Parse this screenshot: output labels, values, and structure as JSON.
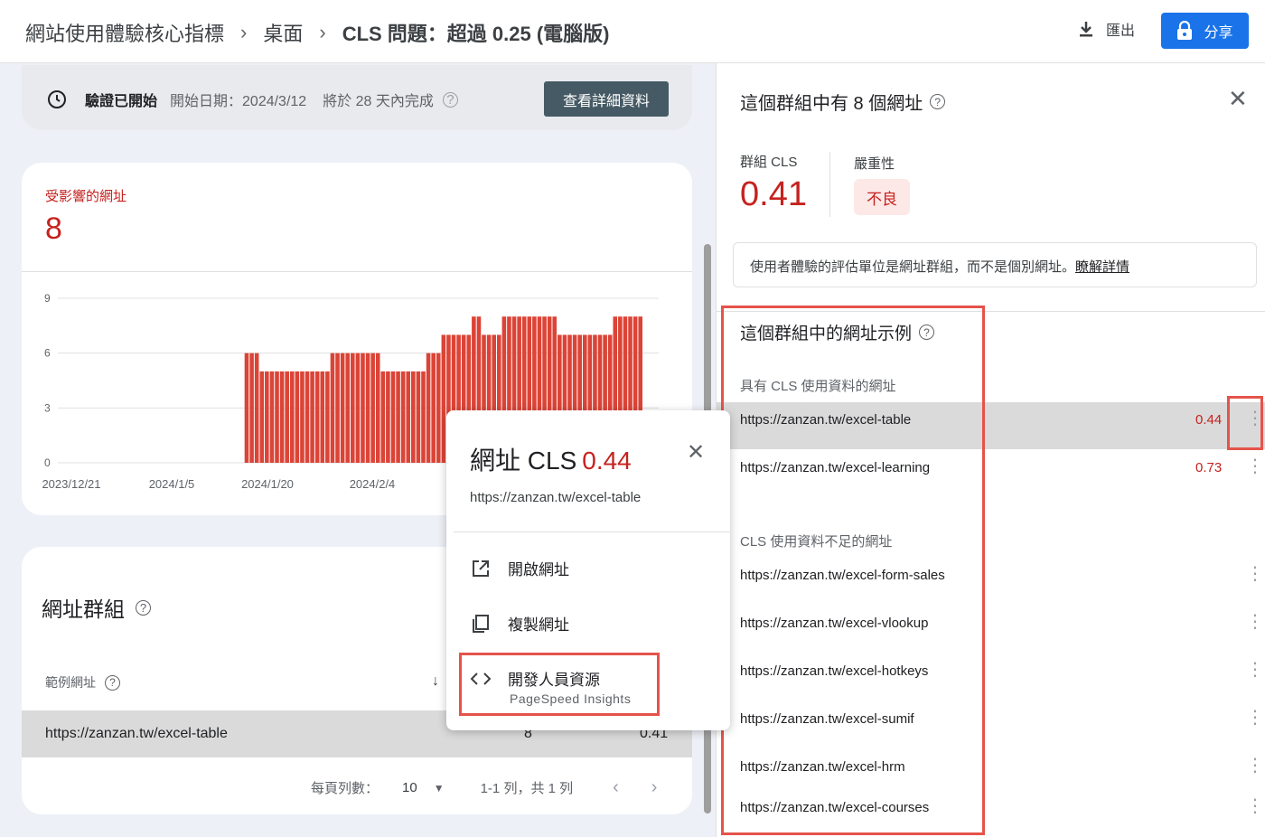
{
  "header": {
    "breadcrumb": [
      "網站使用體驗核心指標",
      "桌面",
      "CLS 問題：超過 0.25 (電腦版)"
    ],
    "export_label": "匯出",
    "share_label": "分享"
  },
  "validation": {
    "status": "驗證已開始",
    "start_date": "開始日期：2024/3/12",
    "eta": "將於 28 天內完成",
    "details_button": "查看詳細資料"
  },
  "affected": {
    "label": "受影響的網址",
    "value": "8"
  },
  "chart_data": {
    "type": "bar",
    "x_tick_labels": [
      "2023/12/21",
      "2024/1/5",
      "2024/1/20",
      "2024/2/4"
    ],
    "y_ticks": [
      0,
      3,
      6,
      9
    ],
    "ylim": [
      0,
      9
    ],
    "color": "#db4437",
    "values": [
      0,
      0,
      0,
      0,
      0,
      0,
      0,
      0,
      0,
      0,
      0,
      0,
      0,
      0,
      0,
      0,
      0,
      0,
      0,
      0,
      0,
      0,
      0,
      0,
      0,
      0,
      0,
      0,
      0,
      0,
      0,
      0,
      0,
      0,
      0,
      0,
      0,
      6,
      6,
      6,
      5,
      5,
      5,
      5,
      5,
      5,
      5,
      5,
      5,
      5,
      5,
      5,
      5,
      5,
      6,
      6,
      6,
      6,
      6,
      6,
      6,
      6,
      6,
      6,
      5,
      5,
      5,
      5,
      5,
      5,
      5,
      5,
      5,
      6,
      6,
      6,
      7,
      7,
      7,
      7,
      7,
      7,
      8,
      8,
      7,
      7,
      7,
      7,
      8,
      8,
      8,
      8,
      8,
      8,
      8,
      8,
      8,
      8,
      8,
      7,
      7,
      7,
      7,
      7,
      7,
      7,
      7,
      7,
      7,
      7,
      8,
      8,
      8,
      8,
      8,
      8
    ]
  },
  "url_group": {
    "title": "網址群組",
    "column_label": "範例網址",
    "row": {
      "url": "https://zanzan.tw/excel-table",
      "count": "8",
      "cls": "0.41"
    },
    "pager": {
      "rows_label": "每頁列數：",
      "rows_value": "10",
      "range": "1-1 列，共 1 列"
    }
  },
  "popup": {
    "title": "網址 CLS",
    "value": "0.44",
    "url": "https://zanzan.tw/excel-table",
    "items": [
      {
        "icon": "open-in-new-icon",
        "label": "開啟網址"
      },
      {
        "icon": "copy-icon",
        "label": "複製網址"
      },
      {
        "icon": "code-icon",
        "label": "開發人員資源",
        "sub": "PageSpeed Insights"
      }
    ]
  },
  "panel": {
    "title": "這個群組中有 8 個網址",
    "group_cls_label": "群組 CLS",
    "group_cls_value": "0.41",
    "severity_label": "嚴重性",
    "severity_value": "不良",
    "info_text": "使用者體驗的評估單位是網址群組，而不是個別網址。",
    "info_link": "瞭解詳情",
    "examples_title": "這個群組中的網址示例",
    "with_data_label": "具有 CLS 使用資料的網址",
    "with_data": [
      {
        "url": "https://zanzan.tw/excel-table",
        "score": "0.44"
      },
      {
        "url": "https://zanzan.tw/excel-learning",
        "score": "0.73"
      }
    ],
    "insufficient_label": "CLS 使用資料不足的網址",
    "insufficient": [
      "https://zanzan.tw/excel-form-sales",
      "https://zanzan.tw/excel-vlookup",
      "https://zanzan.tw/excel-hotkeys",
      "https://zanzan.tw/excel-sumif",
      "https://zanzan.tw/excel-hrm",
      "https://zanzan.tw/excel-courses"
    ]
  }
}
